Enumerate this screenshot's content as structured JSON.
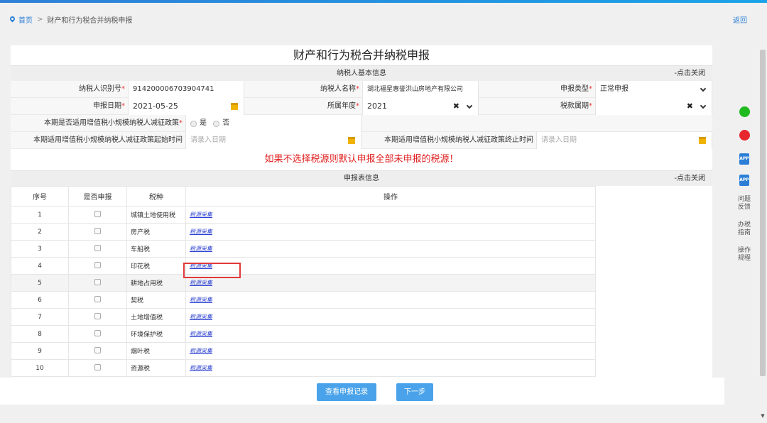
{
  "breadcrumb": {
    "home": "首页",
    "separator": ">",
    "current": "财产和行为税合并纳税申报"
  },
  "back_label": "返回",
  "title": "财产和行为税合并纳税申报",
  "basic_section": {
    "header": "纳税人基本信息",
    "close": "-点击关闭"
  },
  "fields": {
    "taxpayer_id": {
      "label": "纳税人识别号",
      "value": "914200006703904741"
    },
    "taxpayer_name": {
      "label": "纳税人名称",
      "value": "湖北福星惠誉洪山房地产有限公司"
    },
    "declare_type": {
      "label": "申报类型",
      "value": "正常申报"
    },
    "declare_date": {
      "label": "申报日期",
      "value": "2021-05-25"
    },
    "year": {
      "label": "所属年度",
      "value": "2021"
    },
    "tax_period": {
      "label": "税款属期",
      "value": ""
    },
    "small_scale_policy": {
      "label": "本期是否适用增值税小规模纳税人减征政策",
      "yes": "是",
      "no": "否"
    },
    "policy_start": {
      "label": "本期适用增值税小规模纳税人减征政策起始时间",
      "placeholder": "请录入日期"
    },
    "policy_end": {
      "label": "本期适用增值税小规模纳税人减征政策终止时间",
      "placeholder": "请录入日期"
    }
  },
  "required_mark": "*",
  "clear_mark": "✖",
  "warning": "如果不选择税源则默认申报全部未申报的税源！",
  "report_section": {
    "header": "申报表信息",
    "close": "-点击关闭"
  },
  "table": {
    "columns": [
      "序号",
      "是否申报",
      "税种",
      "操作"
    ],
    "op_label": "税源采集",
    "rows": [
      {
        "no": "1",
        "tax": "城镇土地使用税"
      },
      {
        "no": "2",
        "tax": "房产税"
      },
      {
        "no": "3",
        "tax": "车船税"
      },
      {
        "no": "4",
        "tax": "印花税"
      },
      {
        "no": "5",
        "tax": "耕地占用税"
      },
      {
        "no": "6",
        "tax": "契税"
      },
      {
        "no": "7",
        "tax": "土地增值税"
      },
      {
        "no": "8",
        "tax": "环境保护税"
      },
      {
        "no": "9",
        "tax": "烟叶税"
      },
      {
        "no": "10",
        "tax": "资源税"
      }
    ]
  },
  "buttons": {
    "records": "查看申报记录",
    "next": "下一步"
  },
  "side": {
    "app_label": "APP",
    "feedback": "问题反馈",
    "guide": "办税指南",
    "rules": "操作规程"
  },
  "colors": {
    "accent": "#4aa3ea",
    "link": "#2d7fd6",
    "warning": "#e02020",
    "highlight": "#e03a3a"
  }
}
